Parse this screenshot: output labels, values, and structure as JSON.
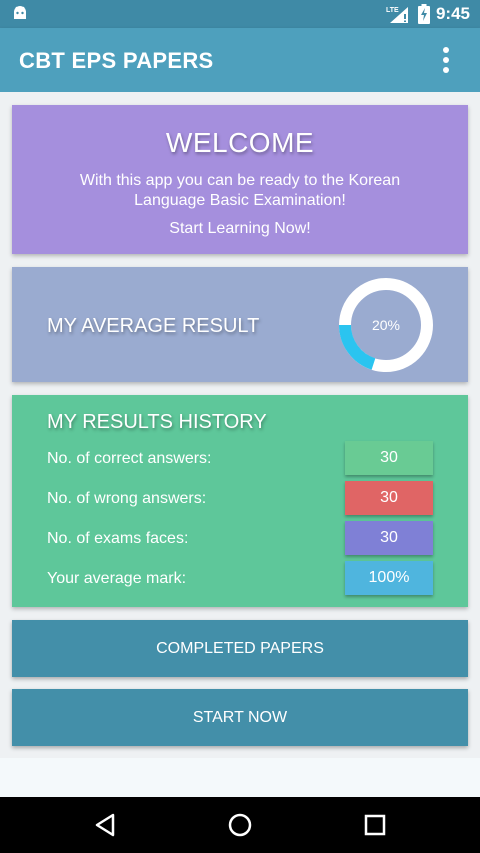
{
  "status_bar": {
    "network_label": "LTE",
    "time": "9:45"
  },
  "app_bar": {
    "title": "CBT EPS PAPERS"
  },
  "welcome": {
    "heading": "WELCOME",
    "message": "With this app you can be ready to the Korean Language Basic Examination!",
    "cta": "Start Learning Now!"
  },
  "average": {
    "label": "MY AVERAGE RESULT",
    "percent_text": "20%",
    "progress_fraction": 0.2,
    "ring_track_color": "#ffffff",
    "ring_fill_color": "#2bc4f0"
  },
  "history": {
    "label": "MY RESULTS HISTORY",
    "rows": [
      {
        "label": "No. of correct answers:",
        "value": "30",
        "color": "#69cb94"
      },
      {
        "label": "No. of wrong answers:",
        "value": "30",
        "color": "#e06565"
      },
      {
        "label": "No. of exams faces:",
        "value": "30",
        "color": "#7f80d6"
      },
      {
        "label": "Your average mark:",
        "value": "100%",
        "color": "#4fb5de"
      }
    ]
  },
  "buttons": {
    "completed": "COMPLETED PAPERS",
    "start": "START NOW"
  }
}
